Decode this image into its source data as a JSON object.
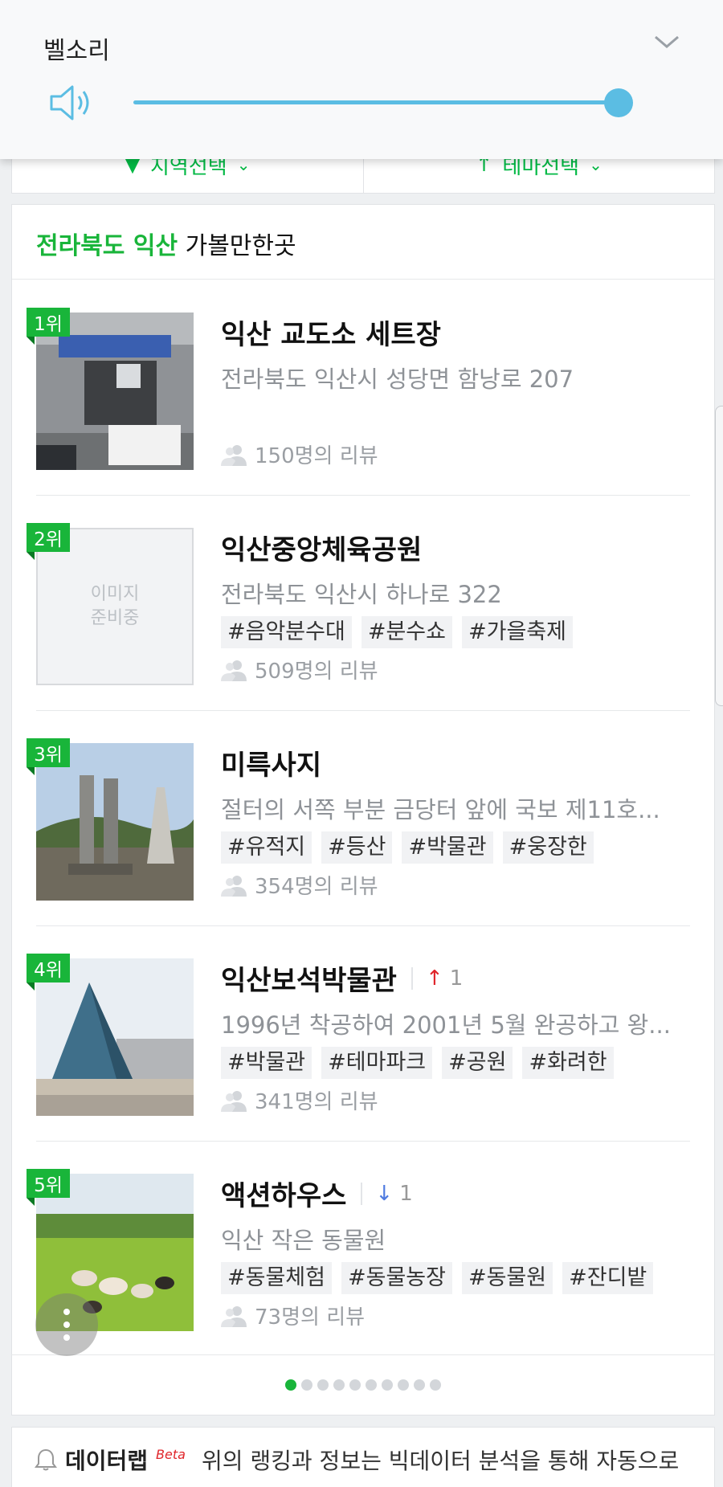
{
  "volume_panel": {
    "title": "벨소리",
    "level": 1.0,
    "icons": [
      "speaker-icon",
      "chevron-down-icon"
    ]
  },
  "filters": [
    {
      "label": "지역선택"
    },
    {
      "label": "테마선택"
    }
  ],
  "section": {
    "location": "전라북도 익산",
    "suffix": "가볼만한곳"
  },
  "items": [
    {
      "rank": "1위",
      "name": "익산 교도소 세트장",
      "change": null,
      "address": "전라북도 익산시 성당면 함낭로 207",
      "tags": [],
      "reviews": "150명의 리뷰",
      "thumb": "prison-set"
    },
    {
      "rank": "2위",
      "name": "익산중앙체육공원",
      "change": null,
      "address": "전라북도 익산시 하나로 322",
      "tags": [
        "#음악분수대",
        "#분수쇼",
        "#가을축제"
      ],
      "reviews": "509명의 리뷰",
      "thumb": "placeholder",
      "placeholder_text": [
        "이미지",
        "준비중"
      ]
    },
    {
      "rank": "3위",
      "name": "미륵사지",
      "change": null,
      "address": "절터의 서쪽 부분 금당터 앞에 국보 제11호...",
      "tags": [
        "#유적지",
        "#등산",
        "#박물관",
        "#웅장한"
      ],
      "reviews": "354명의 리뷰",
      "thumb": "temple-site"
    },
    {
      "rank": "4위",
      "name": "익산보석박물관",
      "change": {
        "dir": "up",
        "value": "1"
      },
      "address": "1996년 착공하여 2001년 5월 완공하고 왕...",
      "tags": [
        "#박물관",
        "#테마파크",
        "#공원",
        "#화려한"
      ],
      "reviews": "341명의 리뷰",
      "thumb": "pyramid-museum"
    },
    {
      "rank": "5위",
      "name": "액션하우스",
      "change": {
        "dir": "down",
        "value": "1"
      },
      "address": "익산 작은 동물원",
      "tags": [
        "#동물체험",
        "#동물농장",
        "#동물원",
        "#잔디밭"
      ],
      "reviews": "73명의 리뷰",
      "thumb": "goat-farm"
    }
  ],
  "pagination": {
    "total": 10,
    "active": 1
  },
  "footer": {
    "brand": "데이터랩",
    "badge": "Beta",
    "text": "위의 랭킹과 정보는 빅데이터 분석을 통해 자동으로"
  },
  "colors": {
    "accent": "#19b53a",
    "volume": "#5bbde3",
    "up": "#e0252a",
    "down": "#4f7be0"
  }
}
